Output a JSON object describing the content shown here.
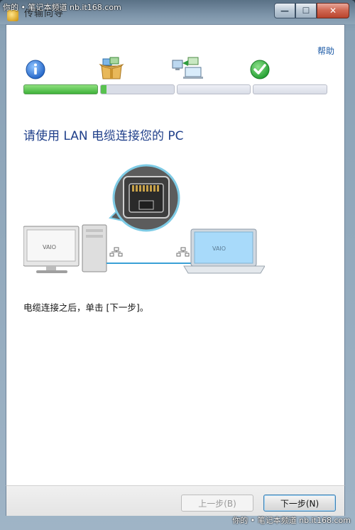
{
  "window": {
    "title": "传输向导",
    "watermark_top": "你的 • 笔记本频道 nb.it168.com",
    "watermark_bottom": "你的 • 笔记本频道 nb.it168.com"
  },
  "header": {
    "help_link": "帮助"
  },
  "steps": [
    {
      "icon": "info-icon",
      "state": "done"
    },
    {
      "icon": "package-icon",
      "state": "current"
    },
    {
      "icon": "transfer-computer-icon",
      "state": "pending"
    },
    {
      "icon": "checkmark-icon",
      "state": "pending"
    }
  ],
  "progress": {
    "completed_fraction": 0.27
  },
  "main": {
    "heading": "请使用 LAN 电缆连接您的 PC",
    "instruction": "电缆连接之后，单击 [下一步]。",
    "desktop_brand": "VAIO",
    "laptop_brand": "VAIO"
  },
  "footer": {
    "back_label": "上一步(B)",
    "next_label": "下一步(N)"
  },
  "colors": {
    "accent": "#1f3f8a",
    "progress_green": "#3fb23a",
    "cable_blue": "#3aa0d6"
  }
}
